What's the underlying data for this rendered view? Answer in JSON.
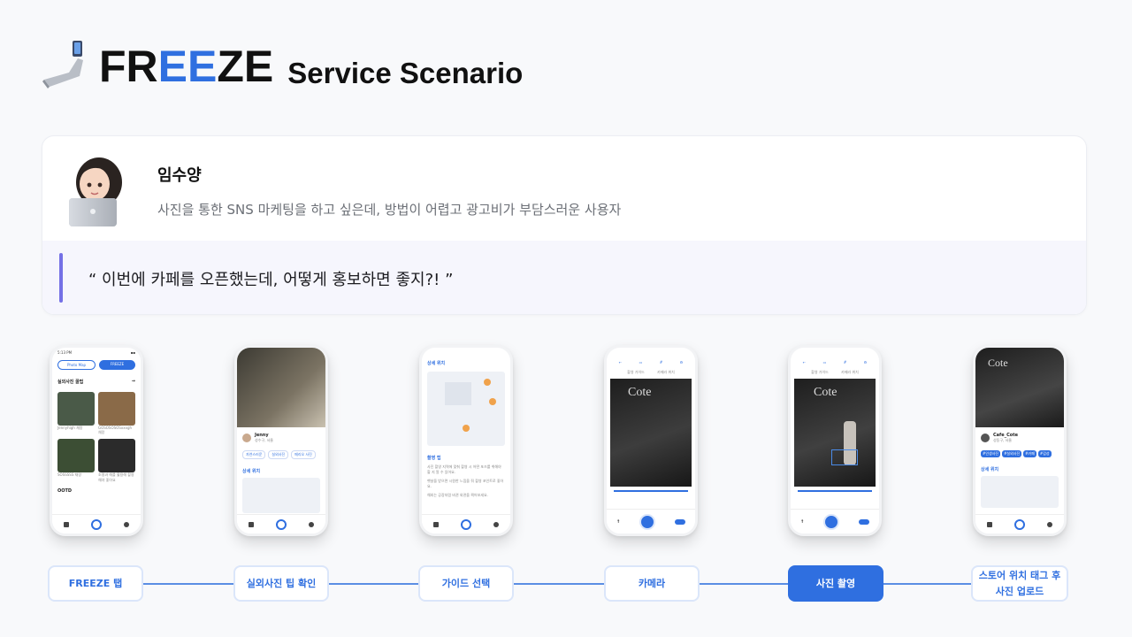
{
  "header": {
    "brand_pre": "FR",
    "brand_mid": "EE",
    "brand_post": "ZE",
    "subtitle": "Service Scenario",
    "icon": "hand-phone-icon"
  },
  "persona": {
    "name": "임수양",
    "description": "사진을 통한 SNS 마케팅을 하고 싶은데, 방법이 어렵고 광고비가 부담스러운 사용자",
    "quote": "“ 이번에 카페를 오픈했는데, 어떻게 홍보하면 좋지?! ”",
    "avatar_icon": "laptop-user-avatar"
  },
  "phones": {
    "p1": {
      "time": "5:13 PM",
      "tab_a": "Photo Map",
      "tab_b": "FREEZE",
      "section": "실외사진 꿀팁",
      "card1": "Jennyhigh 채랑",
      "card2": "GOSOSOSOSxxxgh 채랑",
      "card3": "SOSSSSS 채랑",
      "card4": "조명과 해를 활용해 촬영해야 좋아요",
      "section2": "OOTD"
    },
    "p2": {
      "name": "Jenny",
      "sub": "성수구, 서울",
      "chip1": "자연스러운",
      "chip2": "실외사진",
      "chip3": "메리오 사진",
      "section": "상세 위치"
    },
    "p3": {
      "section": "상세 위치",
      "tips": "촬영 팁",
      "tip1": "사진 촬영 지역에 맞춰 촬영 시 어떤 포즈를 취해야 할 지 알 수 있어요.",
      "tip2": "햇살을 받으면 시원한 느낌을 줘 촬영 포인트로 좋아요.",
      "tip3": "해외는 공장처럼 바뀐 외관을 찍어보세요."
    },
    "p4": {
      "label1": "촬영 가이드",
      "label2": "카메라 위치"
    },
    "p5": {
      "label1": "촬영 가이드",
      "label2": "카메라 위치"
    },
    "p6": {
      "name": "Cafe_Cote",
      "sub": "성동구, 서울",
      "chip1": "#인생사진",
      "chip2": "#실외사진",
      "chip3": "#카페",
      "chip4": "#감성",
      "section": "상세 위치"
    }
  },
  "steps": [
    {
      "label": "FREEZE 탭"
    },
    {
      "label": "실외사진 팁 확인"
    },
    {
      "label": "가이드 선택"
    },
    {
      "label": "카메라"
    },
    {
      "label": "사진 촬영"
    },
    {
      "label": "스토어 위치 태그 후 사진 업로드"
    }
  ],
  "colors": {
    "accent": "#2f6fe0",
    "quote_bar": "#7470e6",
    "quote_bg": "#f6f6fd"
  }
}
